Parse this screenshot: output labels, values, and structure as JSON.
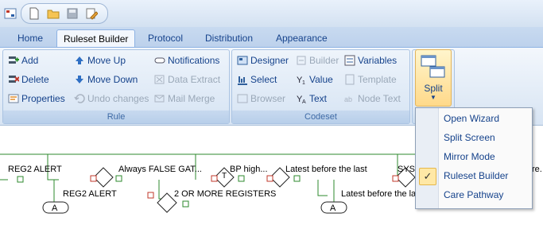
{
  "tabs": [
    "Home",
    "Ruleset Builder",
    "Protocol",
    "Distribution",
    "Appearance"
  ],
  "rule_group": {
    "title": "Rule",
    "buttons": [
      "Add",
      "Delete",
      "Properties",
      "Move Up",
      "Move Down",
      "Undo changes",
      "Notifications",
      "Data Extract",
      "Mail Merge"
    ]
  },
  "codeset_group": {
    "title": "Codeset",
    "buttons": [
      "Designer",
      "Select",
      "Browser",
      "Builder",
      "Value",
      "Text",
      "Variables",
      "Template",
      "Node Text"
    ]
  },
  "split": {
    "label": "Split"
  },
  "split_menu": {
    "items": [
      "Open Wizard",
      "Split Screen",
      "Mirror Mode",
      "Ruleset Builder",
      "Care Pathway"
    ],
    "checked": "Ruleset Builder"
  },
  "diagram": {
    "labels": [
      "REG2 ALERT",
      "REG2 ALERT",
      "Always FALSE GAT...",
      "2 OR MORE REGISTERS",
      "BP high...",
      "Latest before the last",
      "Latest before the la",
      "SYS",
      "re."
    ],
    "node_a": "A",
    "node_t": "T"
  }
}
